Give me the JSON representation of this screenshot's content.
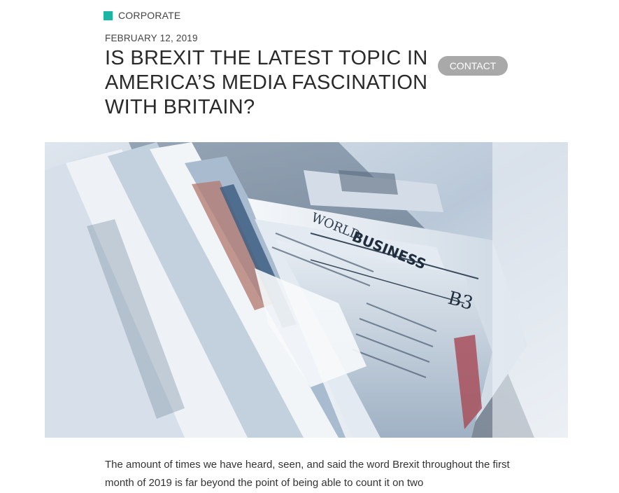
{
  "article": {
    "category": "CORPORATE",
    "date": "FEBRUARY 12, 2019",
    "title": "IS BREXIT THE LATEST TOPIC IN AMERICA’S MEDIA FASCINATION WITH BRITAIN?",
    "contact_label": "CONTACT",
    "body_intro": "The amount of times we have heard, seen, and said the word Brexit throughout the first month of 2019 is far beyond the point of being able to count it on two"
  },
  "hero_image": {
    "texts": {
      "world": "WORLD",
      "business": "BUSINESS",
      "page": "B3"
    }
  },
  "colors": {
    "accent": "#1ab5a3",
    "button": "#a9a9a9"
  }
}
